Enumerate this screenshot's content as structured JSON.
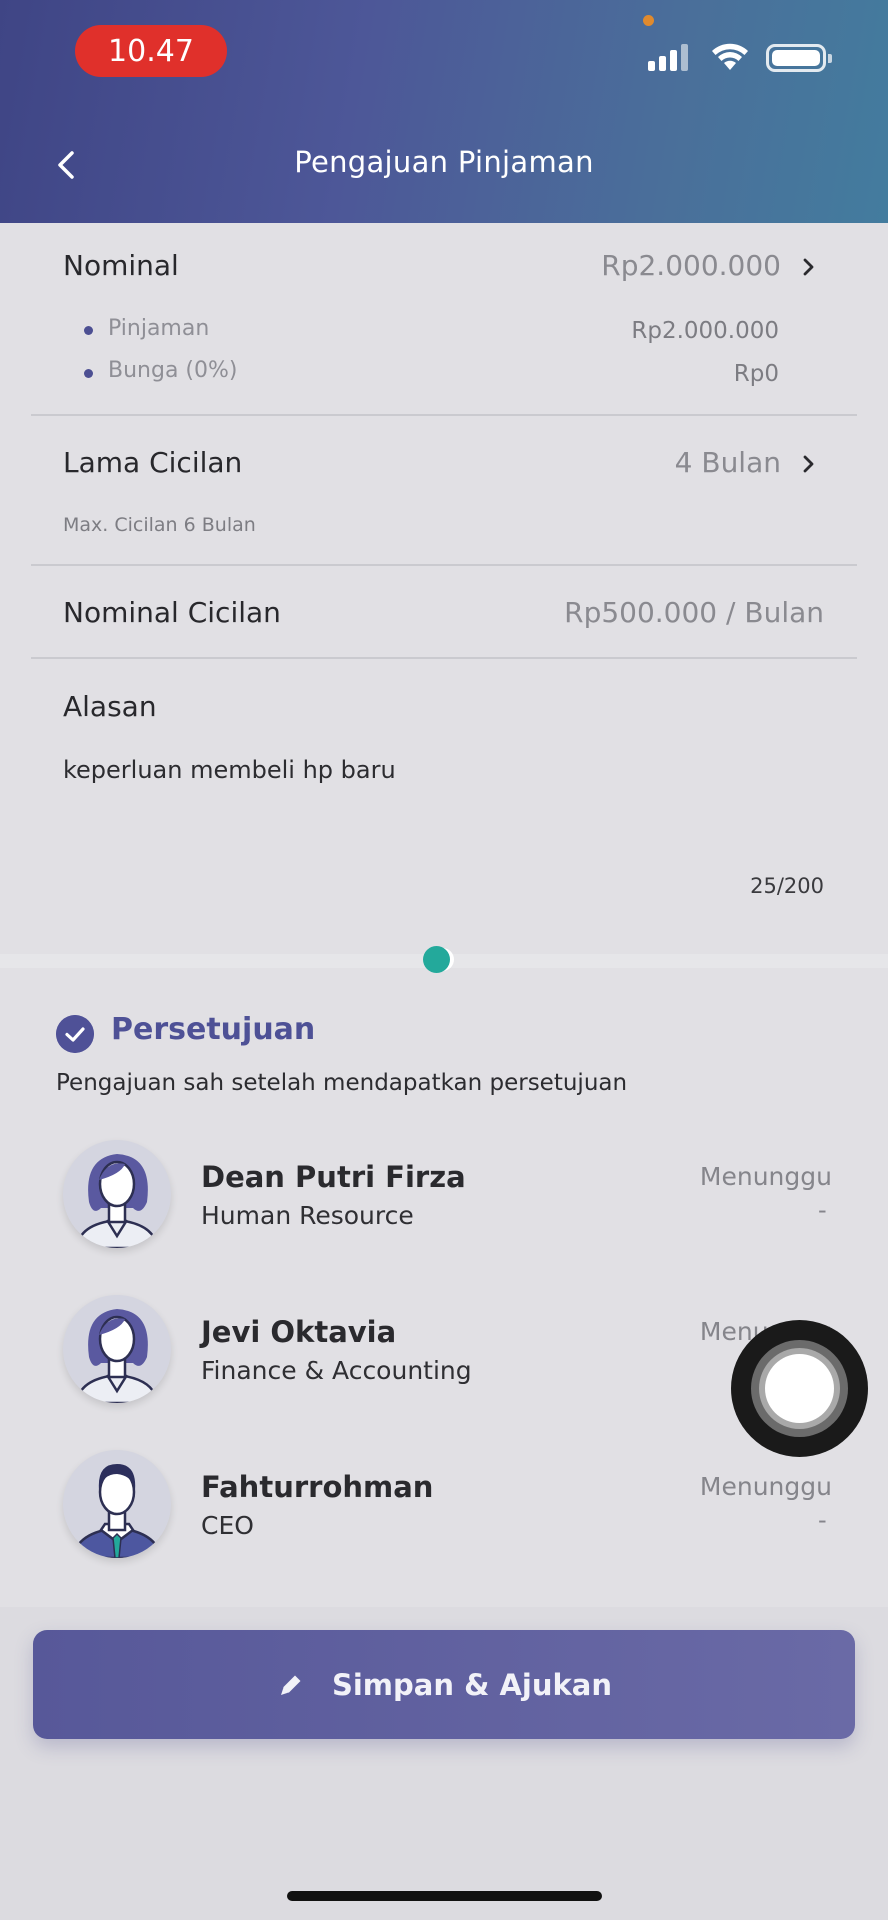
{
  "status_bar": {
    "time": "10.47"
  },
  "header": {
    "title": "Pengajuan Pinjaman"
  },
  "nominal": {
    "label": "Nominal",
    "value": "Rp2.000.000",
    "items": [
      {
        "label": "Pinjaman",
        "value": "Rp2.000.000"
      },
      {
        "label": "Bunga (0%)",
        "value": "Rp0"
      }
    ]
  },
  "lama_cicilan": {
    "label": "Lama Cicilan",
    "value": "4 Bulan",
    "note": "Max. Cicilan 6 Bulan"
  },
  "nominal_cicilan": {
    "label": "Nominal Cicilan",
    "value": "Rp500.000 / Bulan"
  },
  "alasan": {
    "label": "Alasan",
    "value": "keperluan membeli hp baru",
    "counter": "25/200"
  },
  "approval": {
    "title": "Persetujuan",
    "description": "Pengajuan sah setelah mendapatkan persetujuan",
    "approvers": [
      {
        "name": "Dean Putri Firza",
        "role": "Human Resource",
        "status": "Menunggu",
        "date": "-"
      },
      {
        "name": "Jevi Oktavia",
        "role": "Finance & Accounting",
        "status": "Menunggu",
        "date": "-"
      },
      {
        "name": "Fahturrohman",
        "role": "CEO",
        "status": "Menunggu",
        "date": "-"
      }
    ]
  },
  "submit": {
    "label": "Simpan & Ajukan"
  },
  "colors": {
    "accent": "#4e5196",
    "teal": "#23a99b",
    "status_time_bg": "#e0302b"
  },
  "icons": [
    "back-arrow-icon",
    "chevron-right-icon",
    "check-circle-icon",
    "pencil-icon",
    "signal-icon",
    "wifi-icon",
    "battery-icon"
  ]
}
